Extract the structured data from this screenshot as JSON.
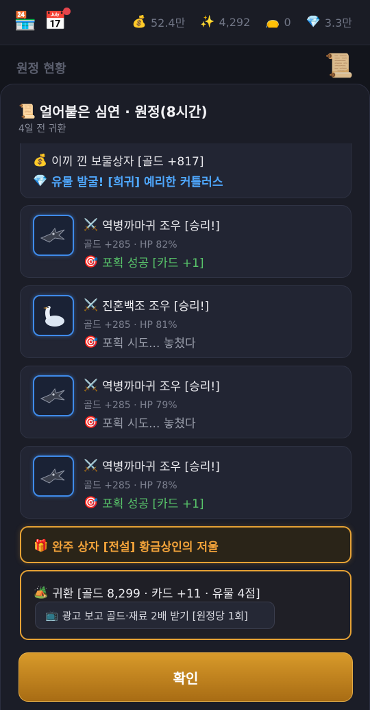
{
  "topbar": {
    "shop_icon": "shop-stall-icon",
    "calendar_icon": "calendar-icon",
    "gold": "52.4만",
    "sparkle": "4,292",
    "bag": "0",
    "gem": "3.3만"
  },
  "background": {
    "title": "원정 현황"
  },
  "modal": {
    "title": "얼어붙은 심연 · 원정(8시간)",
    "subtitle": "4일 전 귀환"
  },
  "loot": {
    "line1": "이끼 낀 보물상자 [골드 +817]",
    "line2": "유물 발굴! [희귀] 예리한 커틀러스"
  },
  "battles": [
    {
      "title": "역병까마귀 조우 [승리!]",
      "stats": "골드 +285 · HP 82%",
      "capture": "포획 성공 [카드 +1]",
      "success": true,
      "creature": "crow"
    },
    {
      "title": "진혼백조 조우 [승리!]",
      "stats": "골드 +285 · HP 81%",
      "capture": "포획 시도... 놓쳤다",
      "success": false,
      "creature": "swan"
    },
    {
      "title": "역병까마귀 조우 [승리!]",
      "stats": "골드 +285 · HP 79%",
      "capture": "포획 시도... 놓쳤다",
      "success": false,
      "creature": "crow"
    },
    {
      "title": "역병까마귀 조우 [승리!]",
      "stats": "골드 +285 · HP 78%",
      "capture": "포획 성공 [카드 +1]",
      "success": true,
      "creature": "crow"
    }
  ],
  "completion": {
    "text": "완주 상자 [전설] 황금상인의 저울"
  },
  "return": {
    "text": "귀환 [골드 8,299 · 카드 +11 · 유물 4점]",
    "ad_button": "광고 보고 골드·재료 2배 받기 [원정당 1회]"
  },
  "confirm_label": "확인",
  "colors": {
    "accent_gold": "#e6a235",
    "success_green": "#58c46a",
    "rare_blue": "#4fa8ff",
    "thumb_border": "#3f8bea"
  }
}
